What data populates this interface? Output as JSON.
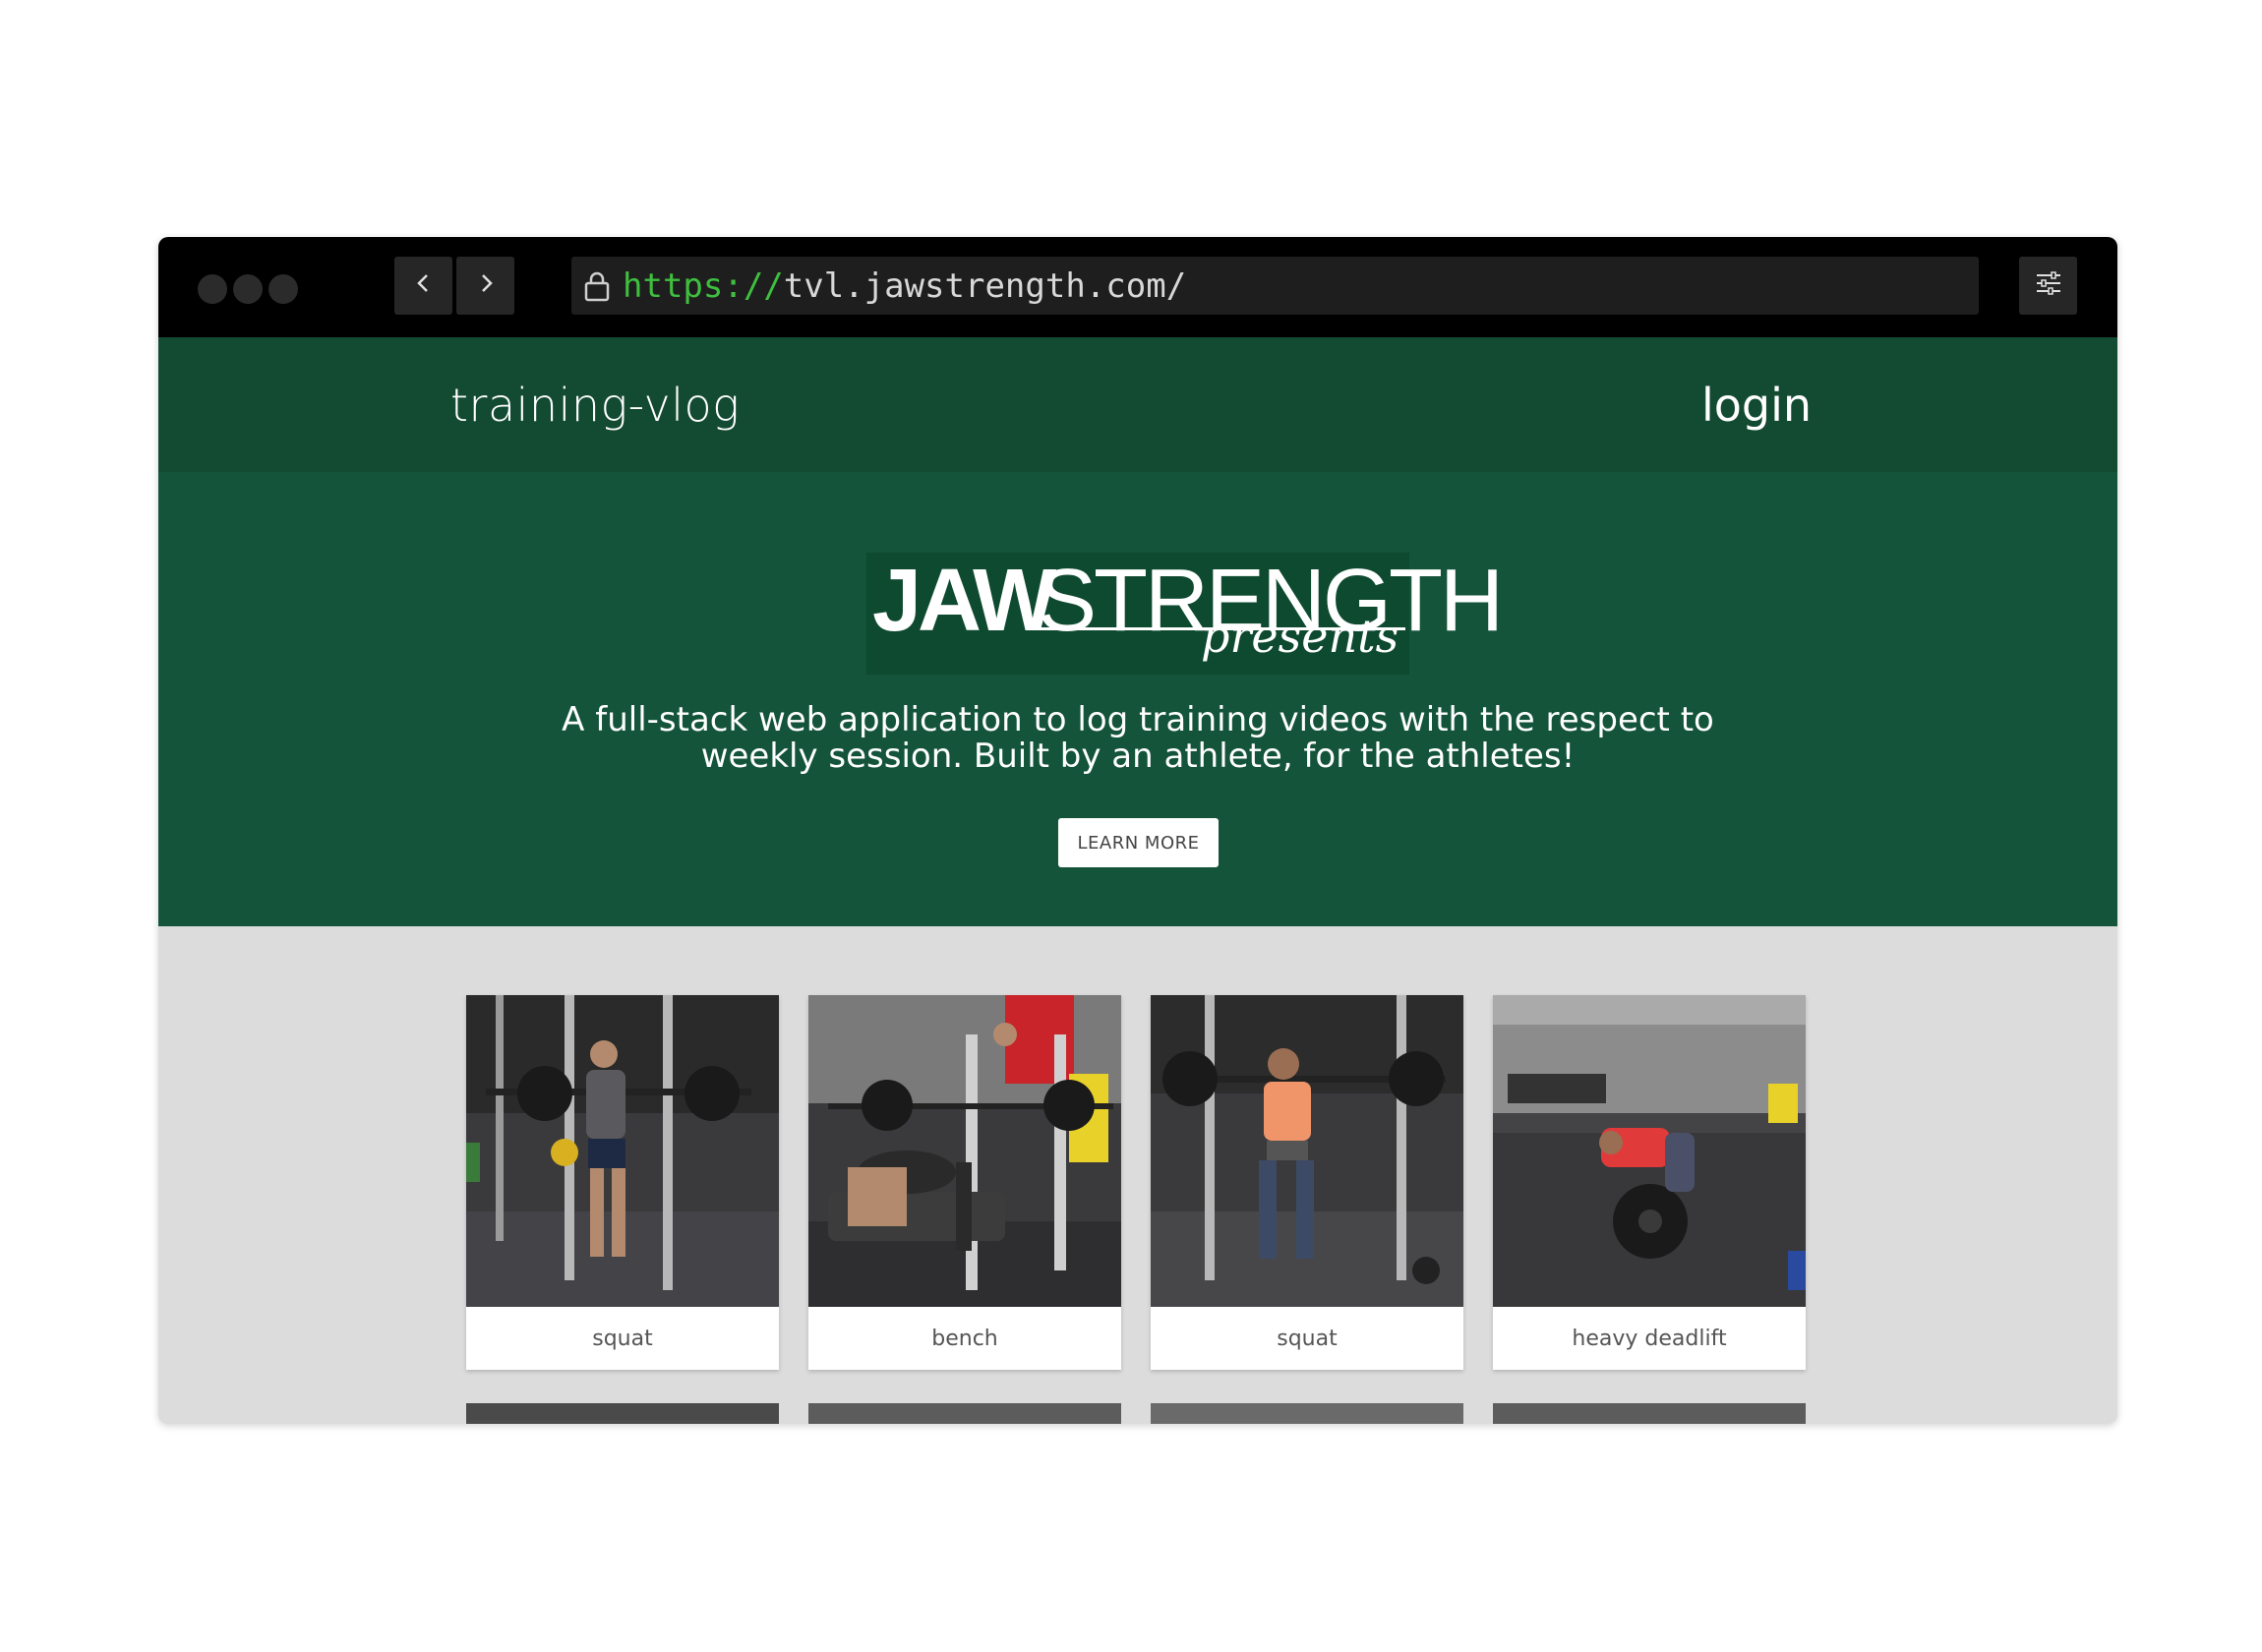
{
  "browser": {
    "url_protocol": "https://",
    "url_rest": "tvl.jawstrength.com/",
    "icons": {
      "back": "chevron-left-icon",
      "forward": "chevron-right-icon",
      "lock": "lock-icon",
      "menu": "sliders-icon"
    }
  },
  "nav": {
    "brand": "training-vlog",
    "login": "login"
  },
  "hero": {
    "logo_bold": "JAW",
    "logo_light": "STRENGTH",
    "logo_script": "presents",
    "tagline": "A full-stack web application to log training videos with the respect to weekly session. Built by an athlete, for the athletes!",
    "button": "LEARN MORE"
  },
  "videos": [
    {
      "title": "squat"
    },
    {
      "title": "bench"
    },
    {
      "title": "squat"
    },
    {
      "title": "heavy deadlift"
    }
  ],
  "colors": {
    "nav_bg": "#134a32",
    "hero_bg": "#13543a",
    "content_bg": "#dcdcdc",
    "url_protocol": "#3fbf3f"
  }
}
